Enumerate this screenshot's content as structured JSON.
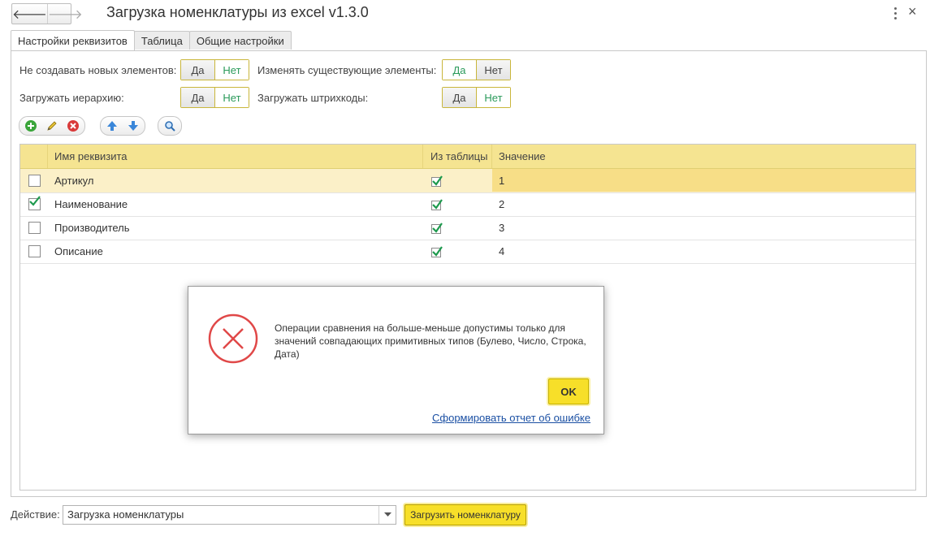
{
  "window": {
    "title": "Загрузка номенклатуры из excel v1.3.0",
    "back_icon": "arrow-left",
    "forward_icon": "arrow-right",
    "menu_icon": "vertical-dots",
    "close_glyph": "×"
  },
  "tabs": [
    {
      "label": "Настройки реквизитов",
      "active": true
    },
    {
      "label": "Таблица",
      "active": false
    },
    {
      "label": "Общие настройки",
      "active": false
    }
  ],
  "settings": {
    "no_new_label": "Не создавать новых элементов:",
    "no_new_yes": "Да",
    "no_new_no": "Нет",
    "no_new_value": "Нет",
    "change_existing_label": "Изменять существующие элементы:",
    "change_existing_yes": "Да",
    "change_existing_no": "Нет",
    "change_existing_value": "Да",
    "load_hierarchy_label": "Загружать иерархию:",
    "load_hierarchy_yes": "Да",
    "load_hierarchy_no": "Нет",
    "load_hierarchy_value": "Нет",
    "load_barcodes_label": "Загружать штрихкоды:",
    "load_barcodes_yes": "Да",
    "load_barcodes_no": "Нет",
    "load_barcodes_value": "Нет"
  },
  "toolbar": {
    "icons": [
      "add-icon",
      "edit-icon",
      "delete-icon",
      "move-up-icon",
      "move-down-icon",
      "search-icon"
    ]
  },
  "table": {
    "columns": {
      "name": "Имя реквизита",
      "from_table": "Из таблицы",
      "value": "Значение"
    },
    "rows": [
      {
        "checked": false,
        "name": "Артикул",
        "from_table": true,
        "value": "1"
      },
      {
        "checked": true,
        "name": "Наименование",
        "from_table": true,
        "value": "2"
      },
      {
        "checked": false,
        "name": "Производитель",
        "from_table": true,
        "value": "3"
      },
      {
        "checked": false,
        "name": "Описание",
        "from_table": true,
        "value": "4"
      }
    ]
  },
  "error_dialog": {
    "icon": "error-circle-x",
    "message": "Операции сравнения на больше-меньше допустимы только для значений совпадающих примитивных типов (Булево, Число, Строка, Дата)",
    "ok_label": "OK",
    "report_link": "Сформировать отчет об ошибке"
  },
  "footer": {
    "action_label": "Действие:",
    "action_value": "Загрузка номенклатуры",
    "load_button": "Загрузить номенклатуру"
  },
  "colors": {
    "accent_yellow": "#f7df29",
    "header_yellow": "#f5e491",
    "selected_green": "#2a9a5a",
    "error_red": "#e04040",
    "link_blue": "#1a4fa3"
  }
}
